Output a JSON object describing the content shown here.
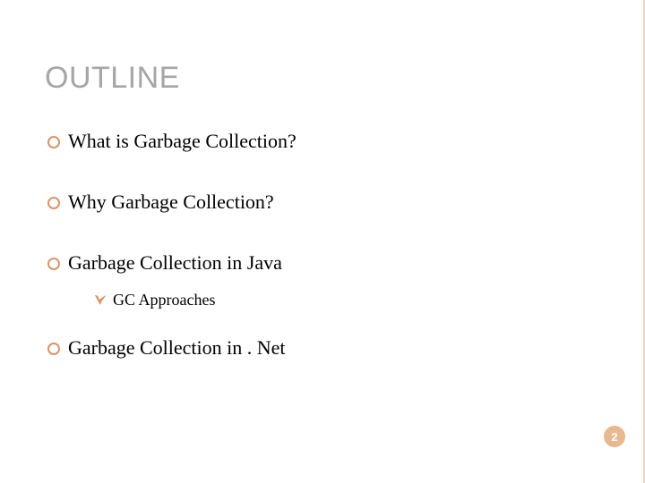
{
  "title": "OUTLINE",
  "items": [
    {
      "text": "What is Garbage Collection?"
    },
    {
      "text": "Why Garbage Collection?"
    },
    {
      "text": "Garbage Collection in Java",
      "sub": [
        {
          "text": "GC Approaches"
        }
      ]
    },
    {
      "text": "Garbage Collection in . Net"
    }
  ],
  "page_number": "2"
}
